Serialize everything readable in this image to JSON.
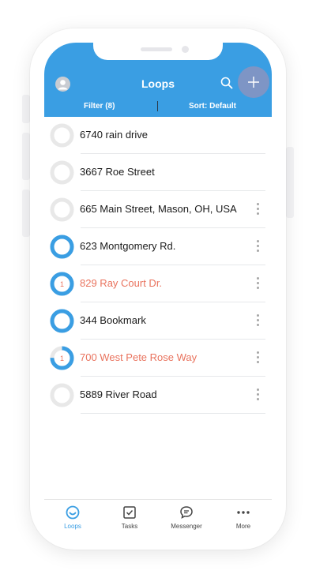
{
  "header": {
    "title": "Loops",
    "filter_label": "Filter (8)",
    "sort_label": "Sort: Default",
    "accent_color": "#3a9ee3"
  },
  "loops": [
    {
      "name": "6740 rain drive",
      "progress": 0,
      "badge": "",
      "alert": false,
      "menu": false
    },
    {
      "name": "3667 Roe Street",
      "progress": 0,
      "badge": "",
      "alert": false,
      "menu": false
    },
    {
      "name": "665 Main Street, Mason, OH, USA",
      "progress": 0,
      "badge": "",
      "alert": false,
      "menu": true
    },
    {
      "name": "623 Montgomery Rd.",
      "progress": 1,
      "badge": "",
      "alert": false,
      "menu": true
    },
    {
      "name": "829 Ray Court Dr.",
      "progress": 1,
      "badge": "1",
      "alert": true,
      "menu": true
    },
    {
      "name": "344 Bookmark",
      "progress": 1,
      "badge": "",
      "alert": false,
      "menu": true
    },
    {
      "name": "700 West Pete Rose Way",
      "progress": 0.75,
      "badge": "1",
      "alert": true,
      "menu": true
    },
    {
      "name": "5889 River Road",
      "progress": 0,
      "badge": "",
      "alert": false,
      "menu": true
    }
  ],
  "tabs": [
    {
      "label": "Loops",
      "icon": "loops-icon",
      "active": true
    },
    {
      "label": "Tasks",
      "icon": "tasks-icon",
      "active": false
    },
    {
      "label": "Messenger",
      "icon": "messenger-icon",
      "active": false
    },
    {
      "label": "More",
      "icon": "more-icon",
      "active": false
    }
  ],
  "colors": {
    "alert": "#e9735e",
    "ring_track": "#e8e8e8",
    "ring_fill": "#3a9ee3"
  }
}
